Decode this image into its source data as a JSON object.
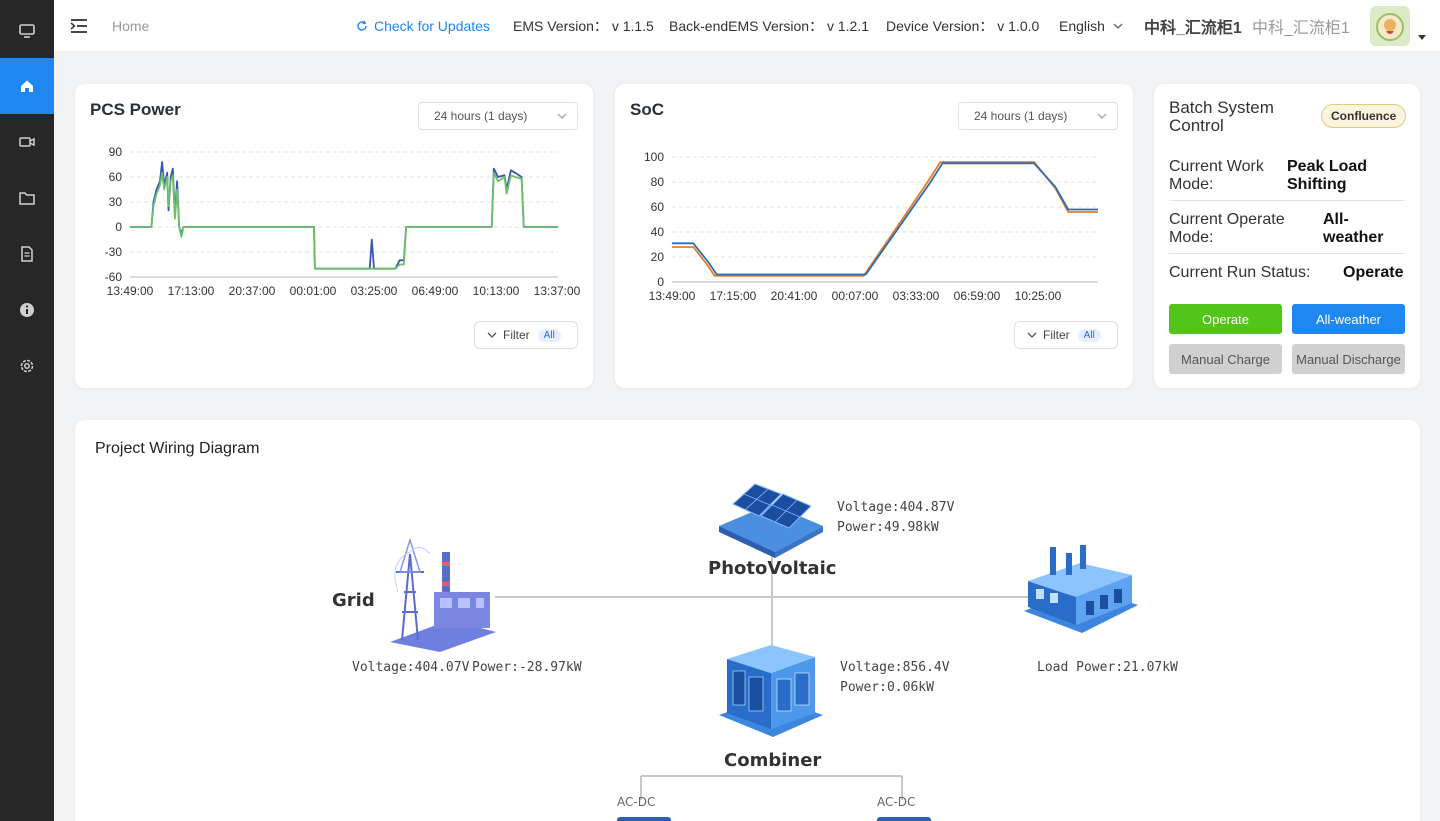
{
  "sidebar": {
    "items": [
      {
        "icon": "monitor-icon",
        "active": false
      },
      {
        "icon": "home-icon",
        "active": true
      },
      {
        "icon": "video-icon",
        "active": false
      },
      {
        "icon": "folder-icon",
        "active": false
      },
      {
        "icon": "document-icon",
        "active": false
      },
      {
        "icon": "info-icon",
        "active": false
      },
      {
        "icon": "gear-icon",
        "active": false
      }
    ],
    "active_color": "#1e87f0"
  },
  "header": {
    "breadcrumb": "Home",
    "check_updates": "Check for Updates",
    "ems_version": "EMS Version： v 1.1.5",
    "backend_version": "Back-endEMS Version： v 1.2.1",
    "device_version": "Device Version： v 1.0.0",
    "language": "English",
    "station": "中科_汇流柜1",
    "station_secondary": "中科_汇流柜1"
  },
  "pcs_power": {
    "title": "PCS Power",
    "range_select": "24 hours (1 days)",
    "filter_label": "Filter",
    "filter_badge": "All"
  },
  "soc": {
    "title": "SoC",
    "range_select": "24 hours (1 days)",
    "filter_label": "Filter",
    "filter_badge": "All"
  },
  "batch": {
    "title": "Batch System Control",
    "mode_tag": "Confluence",
    "work_mode_label": "Current Work Mode:",
    "work_mode_value": "Peak Load Shifting",
    "operate_mode_label": "Current Operate Mode:",
    "operate_mode_value": "All-weather",
    "run_status_label": "Current Run Status:",
    "run_status_value": "Operate",
    "buttons": {
      "operate": "Operate",
      "all_weather": "All-weather",
      "manual_charge": "Manual Charge",
      "manual_discharge": "Manual Discharge"
    }
  },
  "wiring": {
    "title": "Project Wiring Diagram",
    "pv_name": "PhotoVoltaic",
    "pv_voltage": "Voltage:404.87V",
    "pv_power": "Power:49.98kW",
    "grid_name": "Grid",
    "grid_voltage": "Voltage:404.07V",
    "grid_power": "Power:-28.97kW",
    "load_power": "Load Power:21.07kW",
    "combiner_name": "Combiner",
    "combiner_voltage": "Voltage:856.4V",
    "combiner_power": "Power:0.06kW",
    "acdc_left": "AC-DC",
    "acdc_right": "AC-DC"
  },
  "chart_data": [
    {
      "type": "line",
      "title": "PCS Power",
      "x_tick_labels": [
        "13:49:00",
        "17:13:00",
        "20:37:00",
        "00:01:00",
        "03:25:00",
        "06:49:00",
        "10:13:00",
        "13:37:00"
      ],
      "y_tick_labels": [
        "90",
        "60",
        "30",
        "0",
        "-30",
        "-60"
      ],
      "ylim": [
        -60,
        90
      ],
      "grid": "horizontal dashed",
      "series": [
        {
          "color": "#3a55b5",
          "points": [
            [
              0,
              0
            ],
            [
              0.05,
              0
            ],
            [
              0.055,
              30
            ],
            [
              0.062,
              45
            ],
            [
              0.07,
              55
            ],
            [
              0.075,
              78
            ],
            [
              0.08,
              50
            ],
            [
              0.087,
              65
            ],
            [
              0.09,
              20
            ],
            [
              0.095,
              60
            ],
            [
              0.1,
              70
            ],
            [
              0.105,
              15
            ],
            [
              0.11,
              55
            ],
            [
              0.115,
              0
            ],
            [
              0.12,
              -8
            ],
            [
              0.125,
              0
            ],
            [
              0.13,
              0
            ],
            [
              0.43,
              0
            ],
            [
              0.432,
              -50
            ],
            [
              0.56,
              -50
            ],
            [
              0.565,
              -15
            ],
            [
              0.57,
              -50
            ],
            [
              0.62,
              -50
            ],
            [
              0.63,
              -40
            ],
            [
              0.64,
              -40
            ],
            [
              0.645,
              0
            ],
            [
              0.845,
              0
            ],
            [
              0.85,
              70
            ],
            [
              0.86,
              60
            ],
            [
              0.875,
              62
            ],
            [
              0.88,
              45
            ],
            [
              0.89,
              68
            ],
            [
              0.9,
              65
            ],
            [
              0.915,
              60
            ],
            [
              0.92,
              0
            ],
            [
              1,
              0
            ]
          ]
        },
        {
          "color": "#6cc06a",
          "points": [
            [
              0,
              0
            ],
            [
              0.05,
              0
            ],
            [
              0.055,
              25
            ],
            [
              0.062,
              40
            ],
            [
              0.07,
              50
            ],
            [
              0.075,
              65
            ],
            [
              0.08,
              45
            ],
            [
              0.087,
              60
            ],
            [
              0.09,
              25
            ],
            [
              0.095,
              55
            ],
            [
              0.1,
              62
            ],
            [
              0.105,
              10
            ],
            [
              0.11,
              45
            ],
            [
              0.115,
              0
            ],
            [
              0.12,
              -12
            ],
            [
              0.125,
              0
            ],
            [
              0.13,
              0
            ],
            [
              0.43,
              0
            ],
            [
              0.432,
              -50
            ],
            [
              0.62,
              -50
            ],
            [
              0.63,
              -45
            ],
            [
              0.64,
              -45
            ],
            [
              0.645,
              0
            ],
            [
              0.845,
              0
            ],
            [
              0.85,
              65
            ],
            [
              0.86,
              55
            ],
            [
              0.875,
              60
            ],
            [
              0.88,
              40
            ],
            [
              0.89,
              62
            ],
            [
              0.9,
              60
            ],
            [
              0.915,
              58
            ],
            [
              0.92,
              0
            ],
            [
              1,
              0
            ]
          ]
        }
      ]
    },
    {
      "type": "line",
      "title": "SoC",
      "x_tick_labels": [
        "13:49:00",
        "17:15:00",
        "20:41:00",
        "00:07:00",
        "03:33:00",
        "06:59:00",
        "10:25:00"
      ],
      "y_tick_labels": [
        "100",
        "80",
        "60",
        "40",
        "20",
        "0"
      ],
      "ylim": [
        0,
        100
      ],
      "grid": "horizontal dashed",
      "series": [
        {
          "color": "#e87c2b",
          "points": [
            [
              0,
              28
            ],
            [
              0.05,
              28
            ],
            [
              0.08,
              15
            ],
            [
              0.1,
              5
            ],
            [
              0.45,
              5
            ],
            [
              0.6,
              80
            ],
            [
              0.63,
              96
            ],
            [
              0.85,
              96
            ],
            [
              0.9,
              75
            ],
            [
              0.93,
              56
            ],
            [
              1,
              56
            ]
          ]
        },
        {
          "color": "#2a6db5",
          "points": [
            [
              0,
              31
            ],
            [
              0.05,
              31
            ],
            [
              0.085,
              16
            ],
            [
              0.105,
              6
            ],
            [
              0.455,
              6
            ],
            [
              0.605,
              79
            ],
            [
              0.635,
              95
            ],
            [
              0.85,
              95
            ],
            [
              0.9,
              76
            ],
            [
              0.93,
              58
            ],
            [
              1,
              58
            ]
          ]
        }
      ]
    }
  ]
}
